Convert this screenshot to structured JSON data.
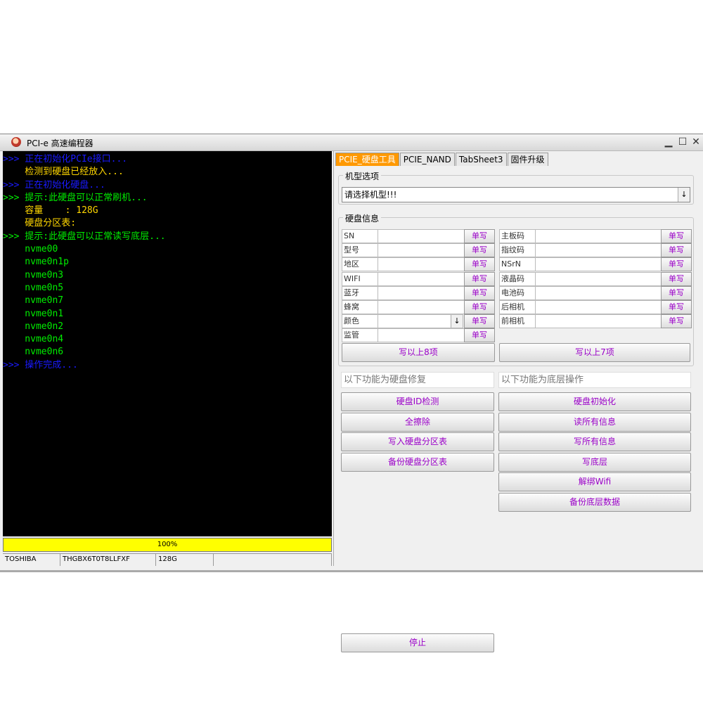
{
  "window": {
    "title": "PCI-e 高速编程器",
    "controls": {
      "minimize": "▁",
      "maximize": "☐",
      "close": "✕"
    }
  },
  "console": {
    "lines": [
      {
        "text": ">>> 正在初始化PCIe接口...",
        "color": "#1a1aff"
      },
      {
        "text": "    检测到硬盘已经放入...",
        "color": "#ffd700"
      },
      {
        "text": ">>> 正在初始化硬盘...",
        "color": "#1a1aff"
      },
      {
        "text": ">>> 提示:此硬盘可以正常刷机...",
        "color": "#00ee00"
      },
      {
        "text": "    容量    : 128G",
        "color": "#ffd700"
      },
      {
        "text": "    硬盘分区表:",
        "color": "#ffd700"
      },
      {
        "text": ">>> 提示:此硬盘可以正常读写底层...",
        "color": "#00ee00"
      },
      {
        "text": "    nvme00",
        "color": "#00ee00"
      },
      {
        "text": "    nvme0n1p",
        "color": "#00ee00"
      },
      {
        "text": "    nvme0n3",
        "color": "#00ee00"
      },
      {
        "text": "    nvme0n5",
        "color": "#00ee00"
      },
      {
        "text": "    nvme0n7",
        "color": "#00ee00"
      },
      {
        "text": "    nvme0n1",
        "color": "#00ee00"
      },
      {
        "text": "    nvme0n2",
        "color": "#00ee00"
      },
      {
        "text": "    nvme0n4",
        "color": "#00ee00"
      },
      {
        "text": "    nvme0n6",
        "color": "#00ee00"
      },
      {
        "text": ">>> 操作完成...",
        "color": "#1a1aff"
      }
    ]
  },
  "progress": {
    "label": "100%",
    "value": 1.0
  },
  "status": {
    "vendor": "TOSHIBA",
    "model": "THGBX6T0T8LLFXF",
    "capacity": "128G",
    "extra": ""
  },
  "tabs": [
    "PCIE_硬盘工具",
    "PCIE_NAND",
    "TabSheet3",
    "固件升级"
  ],
  "model_options": {
    "title": "机型选项",
    "selected": "请选择机型!!!"
  },
  "disk_info": {
    "title": "硬盘信息",
    "write_button": "单写",
    "left_fields": [
      "SN",
      "型号",
      "地区",
      "WIFI",
      "蓝牙",
      "蜂窝",
      "颜色",
      "监管"
    ],
    "right_fields": [
      "主板码",
      "指纹码",
      "NSrN",
      "液晶码",
      "电池码",
      "后相机",
      "前相机"
    ],
    "write_left_all": "写以上8项",
    "write_right_all": "写以上7项"
  },
  "repair": {
    "left_title": "以下功能为硬盘修复",
    "right_title": "以下功能为底层操作",
    "left_buttons": [
      "硬盘ID检测",
      "全擦除",
      "写入硬盘分区表",
      "备份硬盘分区表"
    ],
    "right_buttons": [
      "硬盘初始化",
      "读所有信息",
      "写所有信息",
      "写底层",
      "解绑Wifi",
      "备份底层数据"
    ],
    "stop_button": "停止"
  }
}
